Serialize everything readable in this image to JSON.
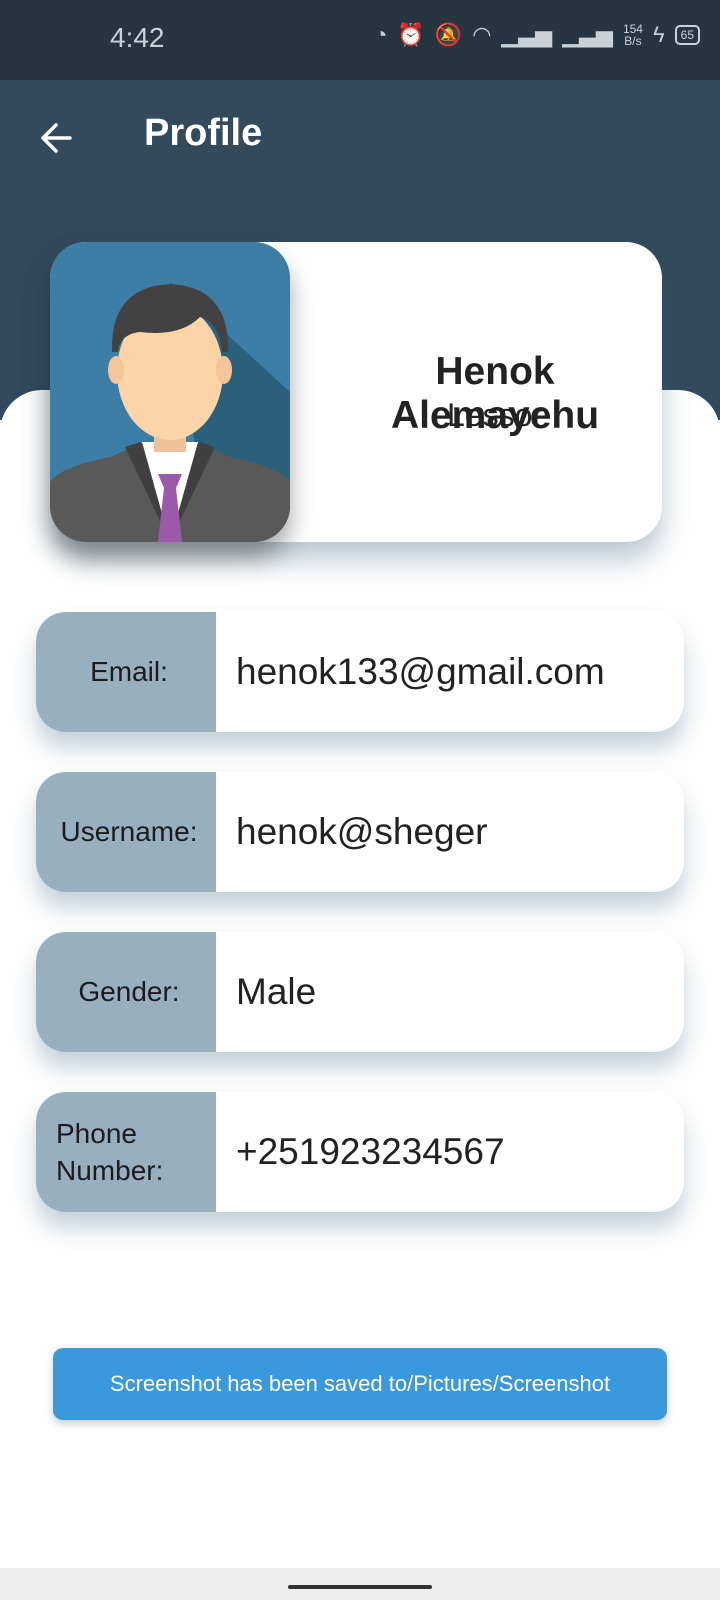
{
  "status_bar": {
    "time": "4:42",
    "net_speed": "154",
    "net_unit": "B/s",
    "battery": "65"
  },
  "header": {
    "title": "Profile"
  },
  "profile": {
    "name": "Henok Alemayehu",
    "role": "Lessor"
  },
  "fields": {
    "email": {
      "label": "Email:",
      "value": "henok133@gmail.com"
    },
    "username": {
      "label": "Username:",
      "value": "henok@sheger"
    },
    "gender": {
      "label": "Gender:",
      "value": "Male"
    },
    "phone": {
      "label": "Phone Number:",
      "value": "+251923234567"
    }
  },
  "toast": {
    "message": "Screenshot has been saved to/Pictures/Screenshot"
  },
  "colors": {
    "header_bg": "#324a5b",
    "label_bg": "#97afbf",
    "toast_bg": "#3a99dc"
  }
}
